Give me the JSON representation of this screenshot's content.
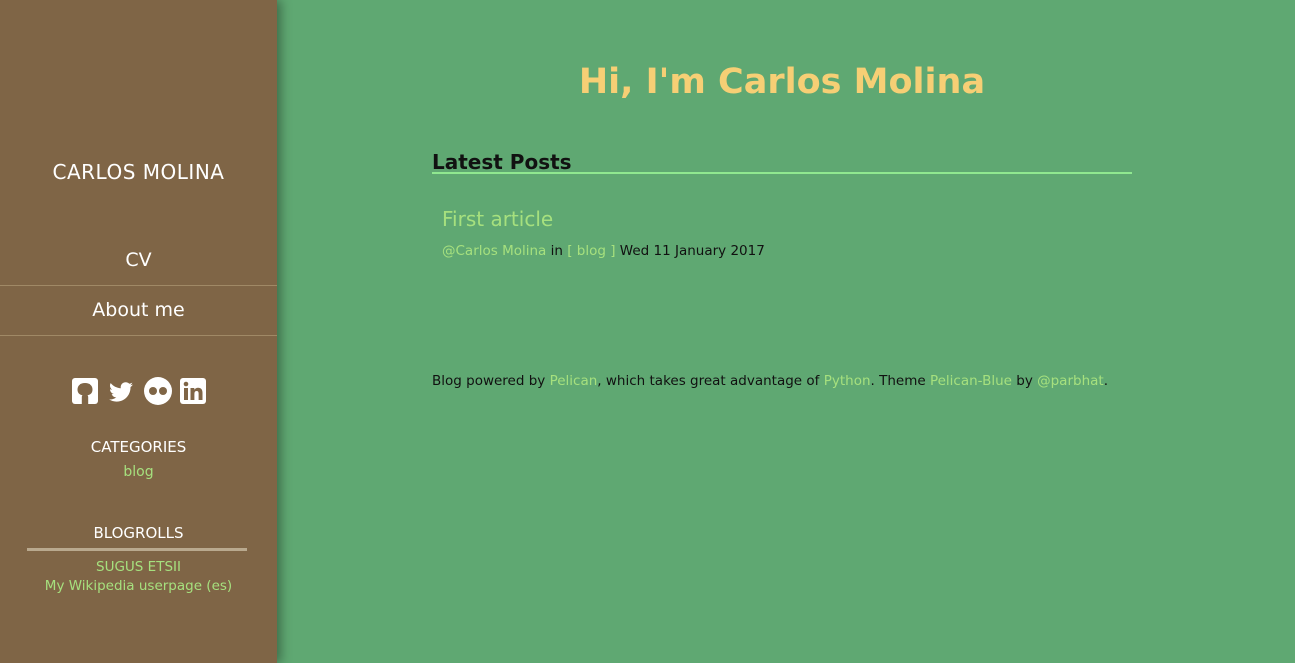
{
  "sidebar": {
    "site_title": "CARLOS MOLINA",
    "nav": [
      {
        "label": "CV"
      },
      {
        "label": "About me"
      }
    ],
    "social_icons": [
      "github-icon",
      "twitter-icon",
      "flickr-icon",
      "linkedin-icon"
    ],
    "categories_title": "CATEGORIES",
    "categories": [
      {
        "label": "blog"
      }
    ],
    "blogrolls_title": "BLOGROLLS",
    "blogrolls": [
      {
        "label": "SUGUS ETSII"
      },
      {
        "label": "My Wikipedia userpage (es)"
      }
    ]
  },
  "main": {
    "heading": "Hi, I'm Carlos Molina",
    "latest_posts_title": "Latest Posts",
    "posts": [
      {
        "title": "First article",
        "author": "@Carlos Molina",
        "in_text": "in",
        "category": "[ blog ]",
        "date": "Wed 11 January 2017"
      }
    ],
    "footer": {
      "text1": "Blog powered by ",
      "link1": "Pelican",
      "text2": ", which takes great advantage of ",
      "link2": "Python",
      "text3": ". Theme ",
      "link3": "Pelican-Blue",
      "text4": " by ",
      "link4": "@parbhat",
      "text5": "."
    }
  },
  "colors": {
    "background": "#5fa872",
    "sidebar": "#7f6546",
    "heading": "#f6cf75",
    "link": "#a6e07e"
  }
}
